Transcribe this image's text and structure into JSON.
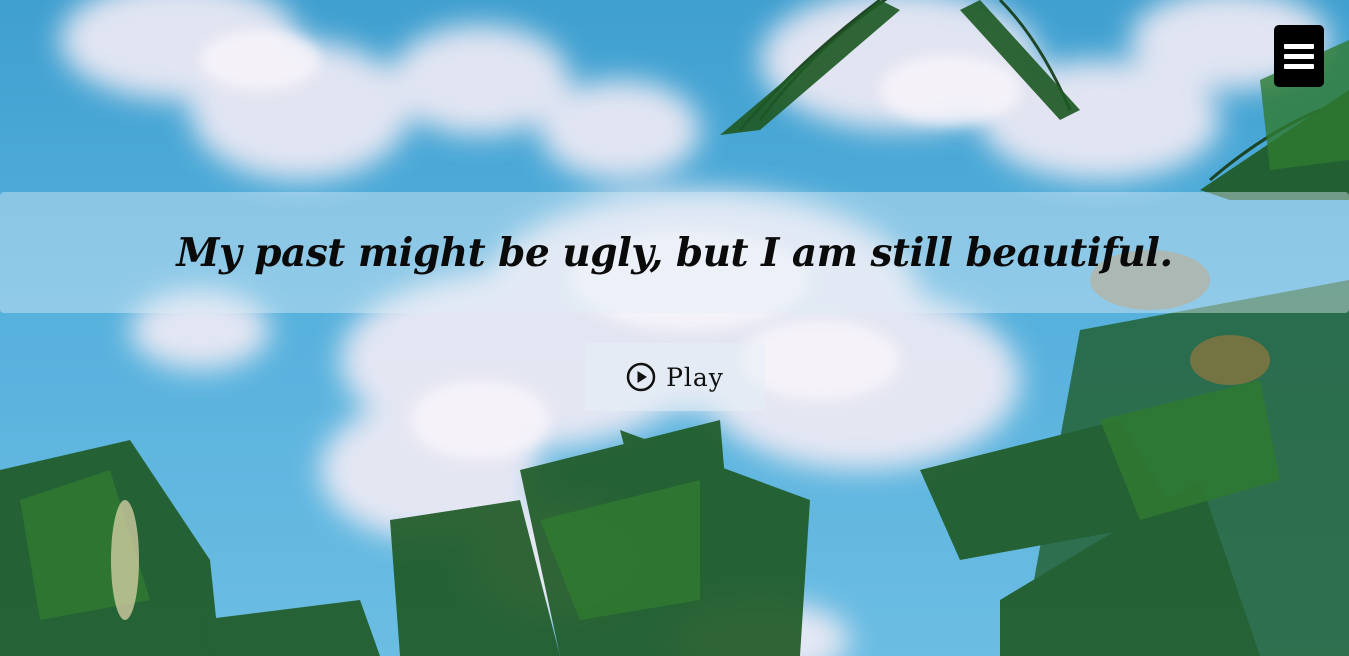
{
  "hero": {
    "quote": "My past might be ugly, but I am still beautiful.",
    "background_description_colors": {
      "sky": "#4aa7d6",
      "cloud": "#f1e9f3",
      "palm_leaf": "#1f5e2a"
    }
  },
  "menu": {
    "icon": "hamburger-icon"
  },
  "player": {
    "play_label": "Play",
    "icon": "play-circle-icon"
  }
}
